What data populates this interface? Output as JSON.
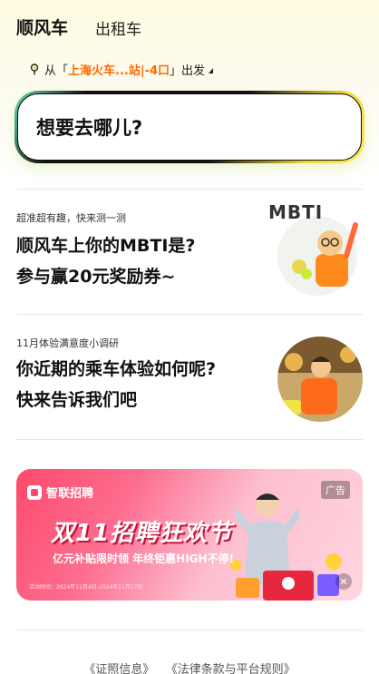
{
  "tabs": {
    "active": "顺风车",
    "other": "出租车"
  },
  "from": {
    "prefix": "从「",
    "location": "上海火车...站|-4口",
    "suffix": "」出发"
  },
  "search": {
    "prompt": "想要去哪儿?"
  },
  "cards": [
    {
      "sub": "超准超有趣，快来测一测",
      "line1": "顺风车上你的MBTI是?",
      "line2": "参与赢20元奖励券~",
      "art_label": "MBTI"
    },
    {
      "sub": "11月体验满意度小调研",
      "line1": "你近期的乘车体验如何呢?",
      "line2": "快来告诉我们吧"
    }
  ],
  "ad": {
    "brand": "智联招聘",
    "badge": "广告",
    "headline": "双11招聘狂欢节",
    "slogan": "亿元补贴限时领 年终钜惠HIGH不停!",
    "fine_print": "活动时间：2024年11月4日-2024年11月17日",
    "close": "✕"
  },
  "footer": {
    "left": "《证照信息》",
    "right": "《法律条款与平台规则》"
  },
  "colors": {
    "accent_orange": "#ff6a00",
    "highlight_green": "#c9ec3a",
    "ad_pink": "#fd4a6b"
  }
}
